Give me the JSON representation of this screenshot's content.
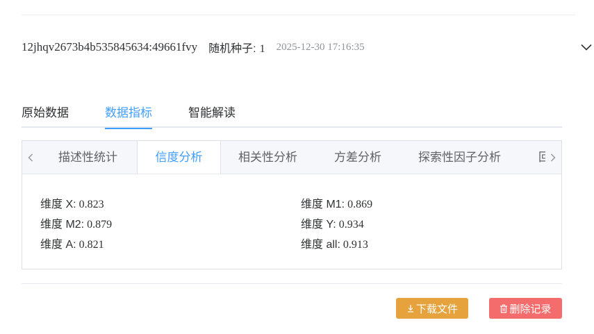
{
  "record": {
    "id": "12jhqv2673b4b535845634:49661fvy",
    "seed_label": "随机种子:",
    "seed_value": "1",
    "timestamp": "2025-12-30 17:16:35",
    "expand_icon": "chevron-down-icon"
  },
  "main_tabs": [
    {
      "label": "原始数据",
      "active": false
    },
    {
      "label": "数据指标",
      "active": true
    },
    {
      "label": "智能解读",
      "active": false
    }
  ],
  "sub_tabs": {
    "prev_icon": "chevron-left-icon",
    "next_icon": "chevron-right-icon",
    "items": [
      {
        "label": "描述性统计",
        "active": false
      },
      {
        "label": "信度分析",
        "active": true
      },
      {
        "label": "相关性分析",
        "active": false
      },
      {
        "label": "方差分析",
        "active": false
      },
      {
        "label": "探索性因子分析",
        "active": false
      },
      {
        "label": "回",
        "active": false
      }
    ]
  },
  "metrics": [
    {
      "label": "维度 X:",
      "value": "0.823"
    },
    {
      "label": "维度 M1:",
      "value": "0.869"
    },
    {
      "label": "维度 M2:",
      "value": "0.879"
    },
    {
      "label": "维度 Y:",
      "value": "0.934"
    },
    {
      "label": "维度 A:",
      "value": "0.821"
    },
    {
      "label": "维度 all:",
      "value": "0.913"
    }
  ],
  "actions": {
    "download_label": "下载文件",
    "download_icon": "download-icon",
    "delete_label": "删除记录",
    "delete_icon": "trash-icon"
  },
  "colors": {
    "accent": "#409eff",
    "download": "#e6a23c",
    "delete": "#f56c6c"
  }
}
